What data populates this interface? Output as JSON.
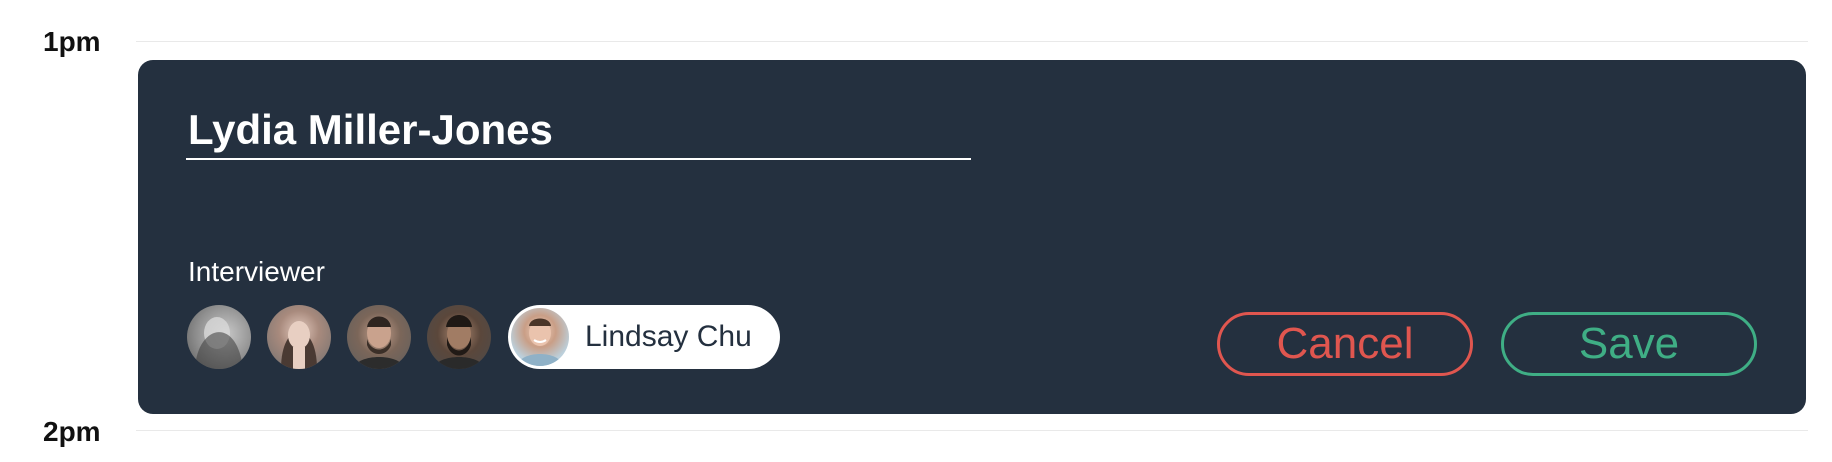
{
  "timeline": {
    "hour_1": "1pm",
    "hour_2": "2pm"
  },
  "event": {
    "candidate_name": "Lydia Miller-Jones",
    "interviewer_label": "Interviewer",
    "interviewers": [
      {
        "icon": "avatar-photo"
      },
      {
        "icon": "avatar-photo"
      },
      {
        "icon": "avatar-photo"
      },
      {
        "icon": "avatar-photo"
      }
    ],
    "selected_interviewer": {
      "name": "Lindsay Chu",
      "icon": "avatar-photo"
    },
    "cancel_label": "Cancel",
    "save_label": "Save"
  },
  "colors": {
    "card_background": "#24303f",
    "cancel": "#e0564f",
    "save": "#3fae85"
  }
}
